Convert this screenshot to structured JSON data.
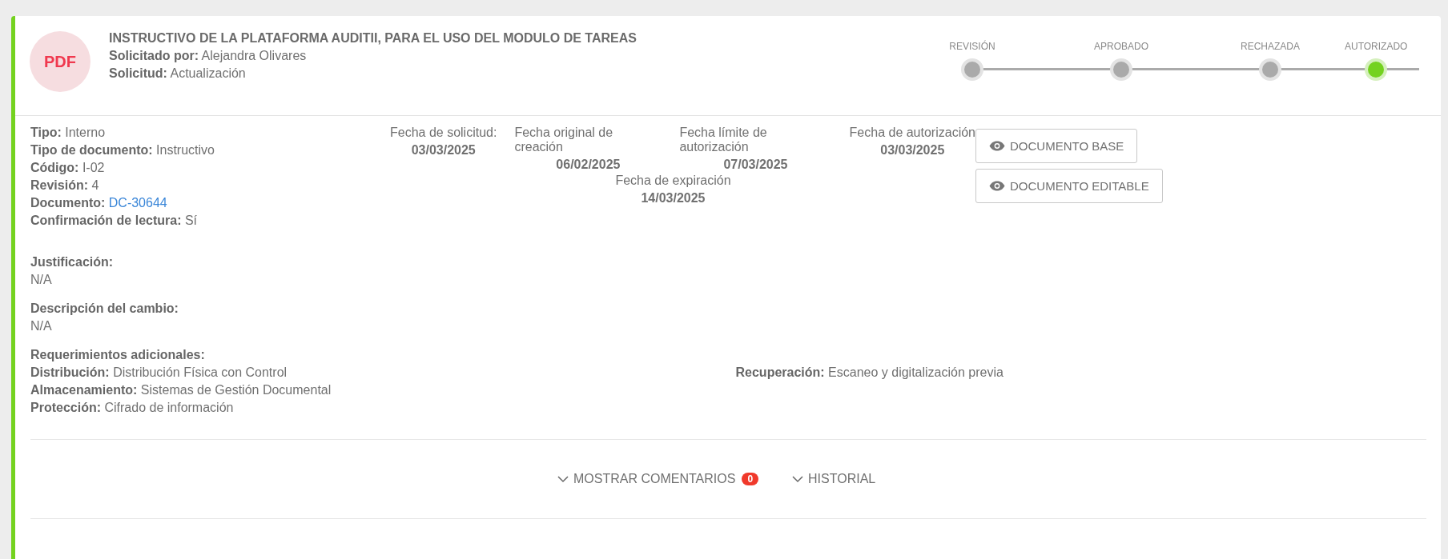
{
  "header": {
    "file_type": "PDF",
    "title": "INSTRUCTIVO DE LA PLATAFORMA AUDITII, PARA EL USO DEL MODULO DE TAREAS",
    "fields": [
      {
        "label": "Solicitado por:",
        "value": "Alejandra Olivares"
      },
      {
        "label": "Solicitud:",
        "value": "Actualización"
      }
    ]
  },
  "status_steps": [
    {
      "label": "REVISIÓN",
      "selected": false
    },
    {
      "label": "APROBADO",
      "selected": false
    },
    {
      "label": "RECHAZADA",
      "selected": false
    },
    {
      "label": "AUTORIZADO",
      "selected": true
    }
  ],
  "details": [
    {
      "label": "Tipo:",
      "value": "Interno",
      "kind": "text"
    },
    {
      "label": "Tipo de documento:",
      "value": "Instructivo",
      "kind": "text"
    },
    {
      "label": "Código:",
      "value": "I-02",
      "kind": "text"
    },
    {
      "label": "Revisión:",
      "value": "4",
      "kind": "text"
    },
    {
      "label": "Documento:",
      "value": "DC-30644",
      "kind": "link"
    },
    {
      "label": "Confirmación de lectura:",
      "value": "Sí",
      "kind": "text"
    }
  ],
  "dates": [
    {
      "label": "Fecha de solicitud:",
      "value": "03/03/2025"
    },
    {
      "label": "Fecha original de creación",
      "value": "06/02/2025"
    },
    {
      "label": "Fecha límite de autorización",
      "value": "07/03/2025"
    },
    {
      "label": "Fecha de autorización",
      "value": "03/03/2025"
    },
    {
      "label": "Fecha de expiración",
      "value": "14/03/2025"
    }
  ],
  "buttons": [
    "DOCUMENTO BASE",
    "DOCUMENTO EDITABLE"
  ],
  "justification": {
    "label": "Justificación:",
    "value": "N/A"
  },
  "change_description": {
    "label": "Descripción del cambio:",
    "value": "N/A"
  },
  "additional_requirements": {
    "label": "Requerimientos adicionales:",
    "left": [
      {
        "label": "Distribución:",
        "value": "Distribución Física con Control"
      },
      {
        "label": "Almacenamiento:",
        "value": "Sistemas de Gestión Documental"
      },
      {
        "label": "Protección:",
        "value": "Cifrado de información"
      }
    ],
    "right": [
      {
        "label": "Recuperación:",
        "value": "Escaneo y digitalización previa"
      }
    ]
  },
  "footer": {
    "comments": {
      "label": "MOSTRAR COMENTARIOS",
      "count": "0"
    },
    "history": {
      "label": "HISTORIAL"
    }
  }
}
